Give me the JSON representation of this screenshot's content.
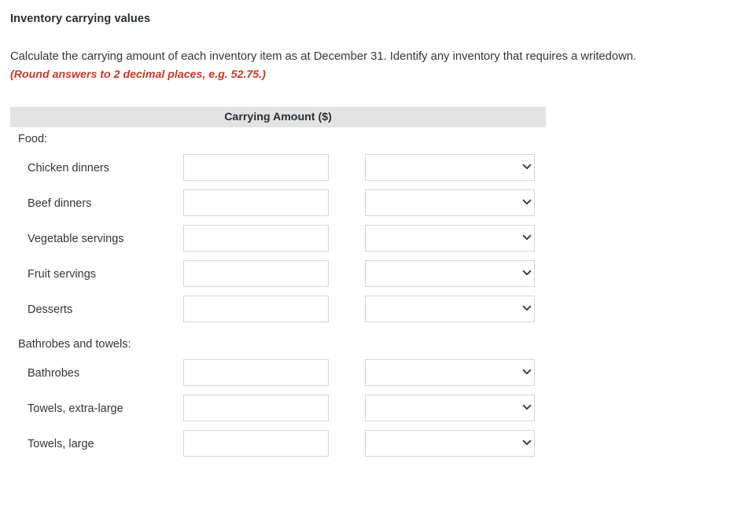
{
  "question": {
    "title": "Inventory carrying values",
    "instruction": "Calculate the carrying amount of each inventory item as at December 31. Identify any inventory that requires a writedown.",
    "rounding_note": "(Round answers to 2 decimal places, e.g. 52.75.)"
  },
  "table": {
    "column_header": "Carrying Amount ($)",
    "groups": [
      {
        "label": "Food:",
        "rows": [
          {
            "label": "Chicken dinners",
            "amount_value": "",
            "amount_placeholder": "",
            "writedown_value": ""
          },
          {
            "label": "Beef dinners",
            "amount_value": "",
            "amount_placeholder": "",
            "writedown_value": ""
          },
          {
            "label": "Vegetable servings",
            "amount_value": "",
            "amount_placeholder": "",
            "writedown_value": ""
          },
          {
            "label": "Fruit servings",
            "amount_value": "",
            "amount_placeholder": "",
            "writedown_value": ""
          },
          {
            "label": "Desserts",
            "amount_value": "",
            "amount_placeholder": "",
            "writedown_value": ""
          }
        ]
      },
      {
        "label": "Bathrobes and towels:",
        "rows": [
          {
            "label": "Bathrobes",
            "amount_value": "",
            "amount_placeholder": "",
            "writedown_value": ""
          },
          {
            "label": "Towels, extra-large",
            "amount_value": "",
            "amount_placeholder": "",
            "writedown_value": ""
          },
          {
            "label": "Towels, large",
            "amount_value": "",
            "amount_placeholder": "",
            "writedown_value": ""
          }
        ]
      }
    ]
  },
  "icons": {
    "dropdown_chevron": "chevron-down-icon"
  },
  "colors": {
    "header_bar_background": "#e3e3e3",
    "note_red": "#c0392b",
    "text": "#33363b",
    "field_border": "#d6d6d6",
    "page_background": "#ffffff"
  }
}
